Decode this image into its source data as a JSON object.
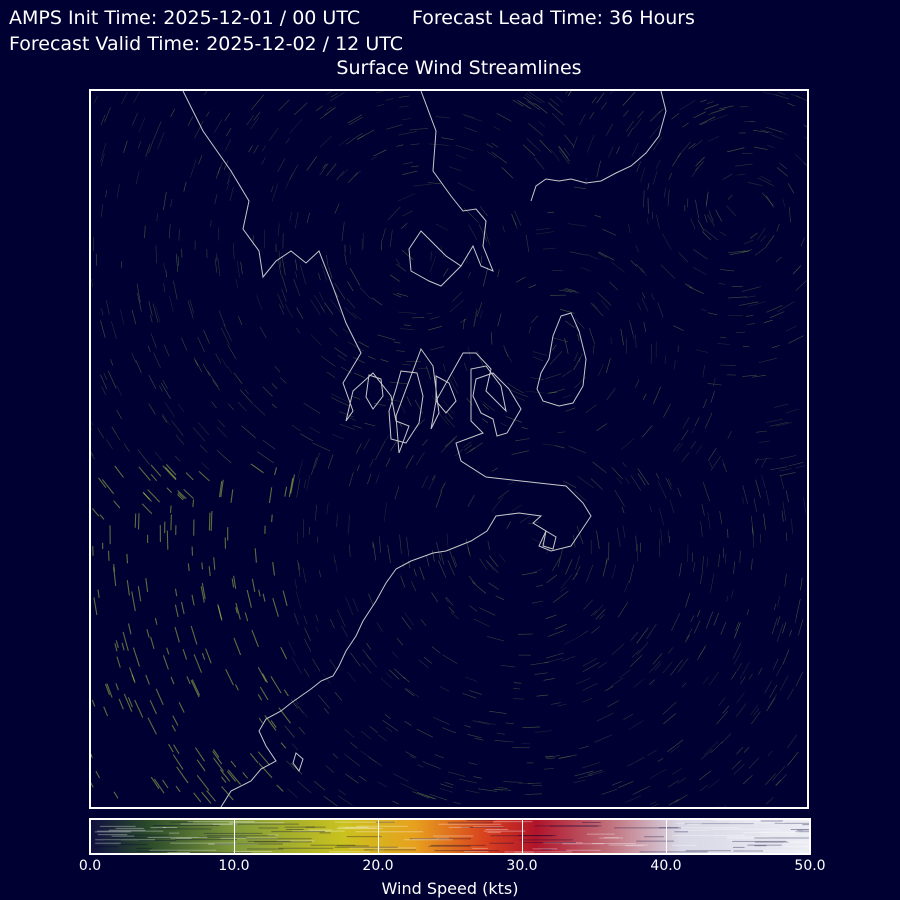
{
  "header": {
    "init_time": "AMPS Init Time: 2025-12-01 / 00 UTC",
    "lead_time": "Forecast Lead Time: 36 Hours",
    "valid_time": "Forecast Valid Time: 2025-12-02 / 12 UTC",
    "title": "Surface Wind Streamlines"
  },
  "colorbar": {
    "label": "Wind Speed (kts)",
    "min": 0,
    "max": 50,
    "ticks": [
      "0.0",
      "10.0",
      "20.0",
      "30.0",
      "40.0",
      "50.0"
    ],
    "colors": [
      "#1a1a55",
      "#5f7d35",
      "#b7c22a",
      "#e0a81a",
      "#c8201e",
      "#c9a5b5",
      "#e8e8f2"
    ]
  },
  "map": {
    "background_color": "#000033",
    "coastline_color": "#c8c8c8",
    "streamline_color": "#8fbf4a"
  }
}
